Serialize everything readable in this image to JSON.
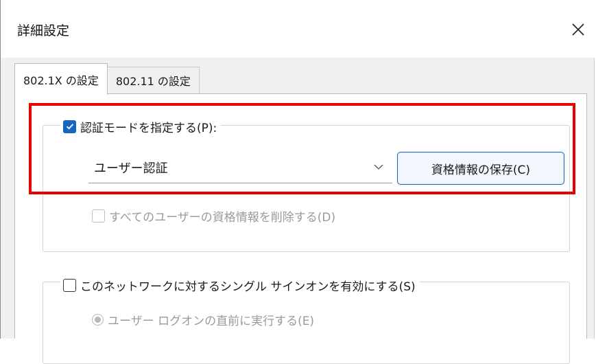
{
  "dialog": {
    "title": "詳細設定"
  },
  "tabs": [
    {
      "label": "802.1X の設定",
      "active": true
    },
    {
      "label": "802.11 の設定",
      "active": false
    }
  ],
  "auth_mode": {
    "checkbox_label": "認証モードを指定する(P):",
    "checked": true,
    "select_value": "ユーザー認証",
    "save_button_label": "資格情報の保存(C)",
    "delete_label": "すべてのユーザーの資格情報を削除する(D)"
  },
  "sso": {
    "checkbox_label": "このネットワークに対するシングル サインオンを有効にする(S)",
    "checked": false,
    "radio_label": "ユーザー ログオンの直前に実行する(E)"
  },
  "colors": {
    "accent": "#1665c0",
    "highlight": "#e60000"
  }
}
